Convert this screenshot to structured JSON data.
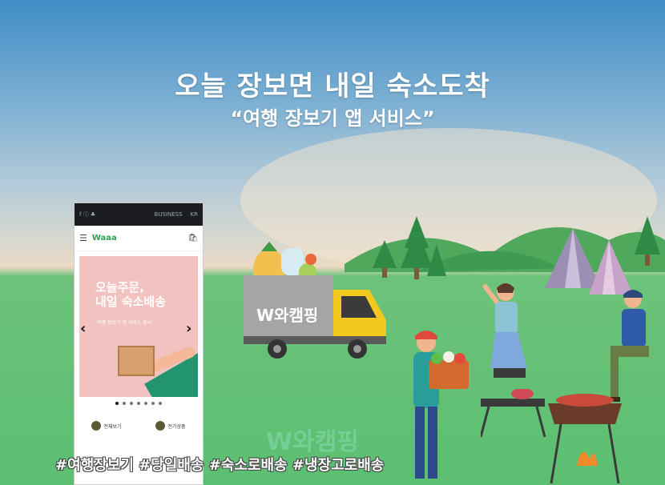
{
  "hero": {
    "title": "오늘 장보면 내일 숙소도착",
    "subtitle": "“여행 장보기 앱 서비스”",
    "hashtags": "#여행장보기 #당일배송 #숙소로배송 #냉장고로배송",
    "watermark": "W와캠핑"
  },
  "truck": {
    "label": "W와캠핑"
  },
  "phone": {
    "status_left": "f ⓘ ♣",
    "status_right": "BUSINESS",
    "status_badge": "KR",
    "app_logo": "Waaa",
    "banner": {
      "headline_1": "오늘주문,",
      "headline_2": "내일 숙소배송",
      "caption": "여행 장보기 앱 서비스 출시"
    },
    "categories": [
      "전체보기",
      "전기상품"
    ]
  },
  "colors": {
    "sky_top": "#3f8cc6",
    "grass": "#5bbf72",
    "banner_pink": "#f1c2c0",
    "truck_body": "#a3a5a6",
    "truck_cab": "#f2c91c"
  }
}
